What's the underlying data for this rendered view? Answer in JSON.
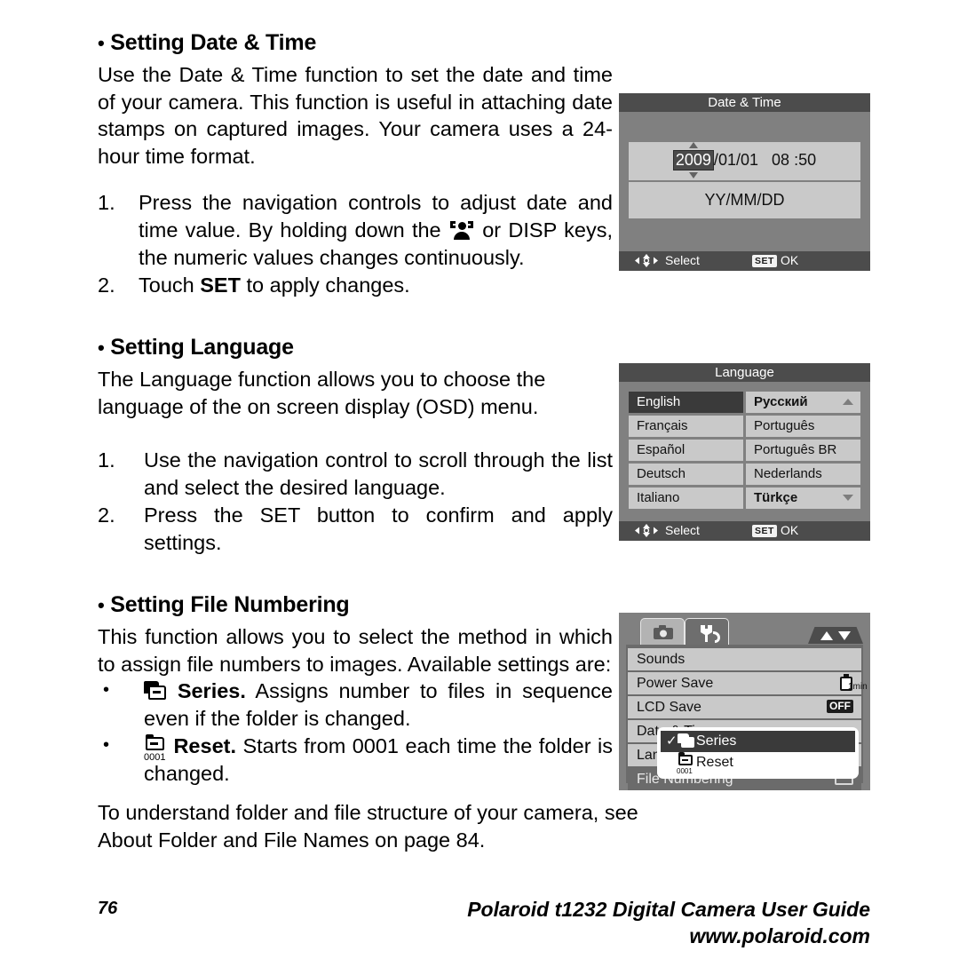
{
  "document": {
    "page_number": "76",
    "footer_title": "Polaroid t1232 Digital Camera User Guide",
    "footer_url": "www.polaroid.com"
  },
  "sections": [
    {
      "heading": "Setting Date & Time",
      "intro": "Use the Date & Time function to set the date and time of your camera. This function is useful in attaching date stamps on captured images. Your camera uses a 24-hour time format.",
      "steps": [
        {
          "num": "1.",
          "text_before_icon": "Press the navigation controls to adjust date and time value. By holding down the ",
          "icon": "portrait-key-icon",
          "text_after_icon": " or DISP keys, the numeric values changes continuously."
        },
        {
          "num": "2.",
          "text": "Touch SET to apply changes.",
          "bold_token": "SET"
        }
      ]
    },
    {
      "heading": "Setting Language",
      "intro": "The Language function allows you to choose the language of the on screen display (OSD) menu.",
      "steps": [
        {
          "num": "1.",
          "text": "Use the navigation control to scroll through the list and select the desired language."
        },
        {
          "num": "2.",
          "text": "Press the SET button to confirm and apply settings."
        }
      ]
    },
    {
      "heading": "Setting File Numbering",
      "intro": "This function allows you to select the method in which to assign file numbers to images. Available settings are:",
      "bullets": [
        {
          "icon": "folder-series-icon",
          "label": "Series.",
          "text": " Assigns number to files in sequence even if the folder is changed."
        },
        {
          "icon": "folder-reset-icon",
          "label": "Reset.",
          "text": " Starts from 0001 each time the folder is changed."
        }
      ]
    }
  ],
  "closing": {
    "line1": "To understand folder and file structure of your camera, see",
    "line2": "About Folder and File Names  on page 84."
  },
  "screens": {
    "datetime": {
      "title": "Date & Time",
      "date": {
        "year": "2009",
        "sep1": "/",
        "month": "01",
        "sep2": "/",
        "day": "01",
        "hour": "08",
        "colon": ":",
        "minute": "50"
      },
      "format": "YY/MM/DD",
      "footer": {
        "select_label": "Select",
        "set_badge": "SET",
        "ok_label": "OK"
      }
    },
    "language": {
      "title": "Language",
      "rows": [
        {
          "left": "English",
          "left_selected": true,
          "right": "Русский",
          "right_bold": true,
          "right_arrow": "up"
        },
        {
          "left": "Français",
          "right": "Português"
        },
        {
          "left": "Español",
          "right": "Português BR"
        },
        {
          "left": "Deutsch",
          "right": "Nederlands"
        },
        {
          "left": "Italiano",
          "right": "Türkçe",
          "right_bold": true,
          "right_arrow": "down"
        }
      ],
      "footer": {
        "select_label": "Select",
        "set_badge": "SET",
        "ok_label": "OK"
      }
    },
    "menu": {
      "tabs": [
        {
          "icon": "camera-icon",
          "active": false
        },
        {
          "icon": "wrench-icon",
          "active": true
        }
      ],
      "scroll_icon": "up-down-arrows-icon",
      "rows": [
        {
          "label": "Sounds",
          "value": ""
        },
        {
          "label": "Power Save",
          "value": "1min",
          "value_icon": "battery-icon"
        },
        {
          "label": "LCD Save",
          "value": "OFF",
          "value_style": "badge"
        },
        {
          "label": "Date & Time",
          "value": ""
        },
        {
          "label": "Language",
          "value": ""
        },
        {
          "label": "File Numbering",
          "value": "",
          "value_icon": "sd-card-icon",
          "highlighted": true
        }
      ],
      "popup": [
        {
          "check": "✓",
          "icon": "folder-series-icon",
          "label": "Series",
          "selected": true
        },
        {
          "check": "",
          "icon": "folder-reset-icon",
          "label": "Reset",
          "selected": false
        }
      ]
    }
  }
}
